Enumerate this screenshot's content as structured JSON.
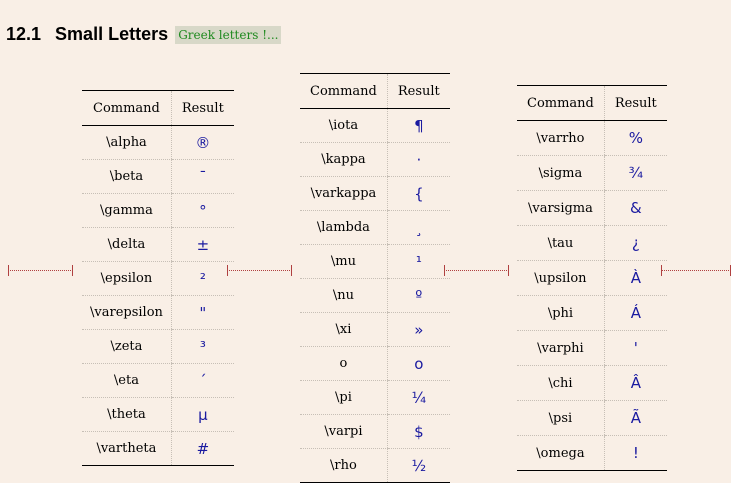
{
  "heading": {
    "number": "12.1",
    "title": "Small Letters",
    "link": "Greek letters !..."
  },
  "headers": {
    "command": "Command",
    "result": "Result"
  },
  "tables": [
    [
      {
        "cmd": "\\alpha",
        "res": "®"
      },
      {
        "cmd": "\\beta",
        "res": "¯"
      },
      {
        "cmd": "\\gamma",
        "res": "°"
      },
      {
        "cmd": "\\delta",
        "res": "±"
      },
      {
        "cmd": "\\epsilon",
        "res": "²"
      },
      {
        "cmd": "\\varepsilon",
        "res": "\""
      },
      {
        "cmd": "\\zeta",
        "res": "³"
      },
      {
        "cmd": "\\eta",
        "res": "´"
      },
      {
        "cmd": "\\theta",
        "res": "µ"
      },
      {
        "cmd": "\\vartheta",
        "res": "#"
      }
    ],
    [
      {
        "cmd": "\\iota",
        "res": "¶"
      },
      {
        "cmd": "\\kappa",
        "res": "·"
      },
      {
        "cmd": "\\varkappa",
        "res": "{"
      },
      {
        "cmd": "\\lambda",
        "res": "¸"
      },
      {
        "cmd": "\\mu",
        "res": "¹"
      },
      {
        "cmd": "\\nu",
        "res": "º"
      },
      {
        "cmd": "\\xi",
        "res": "»"
      },
      {
        "cmd": "o",
        "res": "o"
      },
      {
        "cmd": "\\pi",
        "res": "¼"
      },
      {
        "cmd": "\\varpi",
        "res": "$"
      },
      {
        "cmd": "\\rho",
        "res": "½"
      }
    ],
    [
      {
        "cmd": "\\varrho",
        "res": "%"
      },
      {
        "cmd": "\\sigma",
        "res": "¾"
      },
      {
        "cmd": "\\varsigma",
        "res": "&"
      },
      {
        "cmd": "\\tau",
        "res": "¿"
      },
      {
        "cmd": "\\upsilon",
        "res": "À"
      },
      {
        "cmd": "\\phi",
        "res": "Á"
      },
      {
        "cmd": "\\varphi",
        "res": "'"
      },
      {
        "cmd": "\\chi",
        "res": "Â"
      },
      {
        "cmd": "\\psi",
        "res": "Ã"
      },
      {
        "cmd": "\\omega",
        "res": "!"
      }
    ]
  ]
}
